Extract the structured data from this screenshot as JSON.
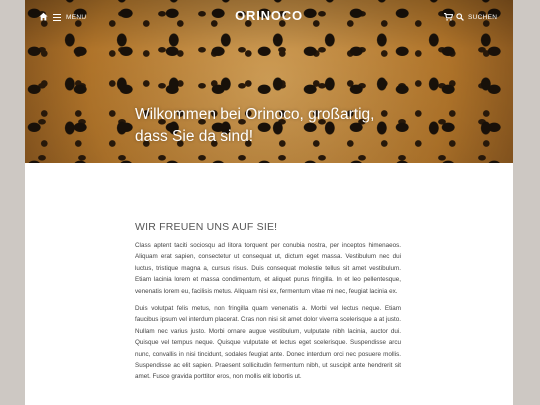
{
  "header": {
    "menu_label": "MENU",
    "logo": "ORINOCO",
    "search_label": "SUCHEN"
  },
  "hero": {
    "heading_line1": "Wilkommen bei Orinoco, großartig,",
    "heading_line2": "dass Sie da sind!"
  },
  "main": {
    "heading": "WIR FREUEN UNS AUF SIE!",
    "paragraphs": [
      "Class aptent taciti sociosqu ad litora torquent per conubia nostra, per inceptos himenaeos. Aliquam erat sapien, consectetur ut consequat ut, dictum eget massa. Vestibulum nec dui luctus, tristique magna a, cursus risus. Duis consequat molestie tellus sit amet vestibulum. Etiam lacinia lorem et massa condimentum, et aliquet purus fringilla. In et leo pellentesque, venenatis lorem eu, facilisis metus. Aliquam nisi ex, fermentum vitae mi nec, feugiat lacinia ex.",
      "Duis volutpat felis metus, non fringilla quam venenatis a. Morbi vel lectus neque. Etiam faucibus ipsum vel interdum placerat. Cras non nisi sit amet dolor viverra scelerisque a at justo. Nullam nec varius justo. Morbi ornare augue vestibulum, vulputate nibh lacinia, auctor dui. Quisque vel tempus neque. Quisque vulputate et lectus eget scelerisque. Suspendisse arcu nunc, convallis in nisi tincidunt, sodales feugiat ante. Donec interdum orci nec posuere mollis. Suspendisse ac elit sapien. Praesent sollicitudin fermentum nibh, ut suscipit ante hendrerit sit amet. Fusce gravida porttitor eros, non mollis elit lobortis ut."
    ]
  },
  "icons": {
    "home": "home-icon",
    "menu": "hamburger-menu-icon",
    "cart": "shopping-cart-icon",
    "search": "search-icon"
  },
  "colors": {
    "page_background": "#cdc8c3",
    "content_background": "#ffffff",
    "header_text": "#ffffff",
    "body_text": "#444444"
  }
}
